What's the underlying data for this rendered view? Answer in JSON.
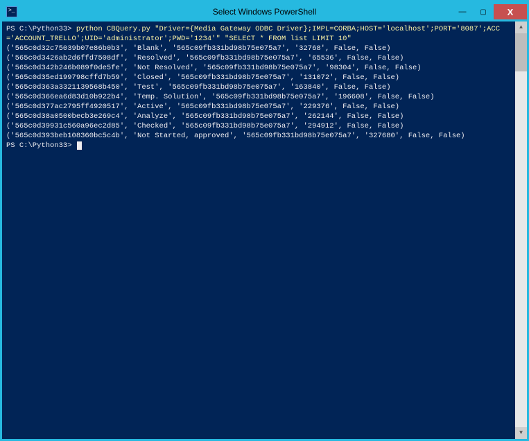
{
  "window": {
    "title": "Select Windows PowerShell",
    "controls": {
      "min": "—",
      "max": "▢",
      "close": "X"
    }
  },
  "terminal": {
    "prompt1_path": "PS C:\\Python33> ",
    "prompt1_cmd": "python CBQuery.py \"Driver={Media Gateway ODBC Driver};IMPL=CORBA;HOST='localhost';PORT='8087';ACC='ACCOUNT_TRELLO';UID='administrator';PWD='1234'\" \"SELECT * FROM list LIMIT 10\"",
    "lines": [
      "('565c0d32c75039b07e86b0b3', 'Blank', '565c09fb331bd98b75e075a7', '32768', False, False)",
      "('565c0d3426ab2d6ffd7508df', 'Resolved', '565c09fb331bd98b75e075a7', '65536', False, False)",
      "('565c0d342b246b089f0de5fe', 'Not Resolved', '565c09fb331bd98b75e075a7', '98304', False, False)",
      "('565c0d35ed199798cffd7b59', 'Closed', '565c09fb331bd98b75e075a7', '131072', False, False)",
      "('565c0d363a3321139568b450', 'Test', '565c09fb331bd98b75e075a7', '163840', False, False)",
      "('565c0d366ea6d83d10b922b4', 'Temp. Solution', '565c09fb331bd98b75e075a7', '196608', False, False)",
      "('565c0d377ac2795ff4920517', 'Active', '565c09fb331bd98b75e075a7', '229376', False, False)",
      "('565c0d38a0500becb3e269c4', 'Analyze', '565c09fb331bd98b75e075a7', '262144', False, False)",
      "('565c0d39931c560a96ec2d85', 'Checked', '565c09fb331bd98b75e075a7', '294912', False, False)",
      "('565c0d393beb108360bc5c4b', 'Not Started, approved', '565c09fb331bd98b75e075a7', '327680', False, False)"
    ],
    "prompt2_path": "PS C:\\Python33> "
  },
  "colors": {
    "titlebar": "#26b9e0",
    "terminal_bg": "#012456",
    "terminal_fg": "#eeedf0",
    "cmd_yellow": "#f9f1a5",
    "close_btn": "#c75050"
  }
}
